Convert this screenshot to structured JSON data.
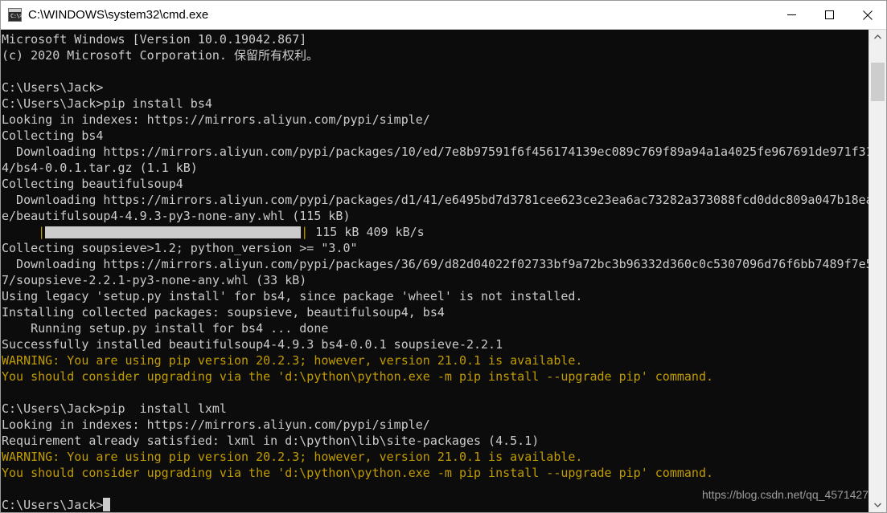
{
  "window": {
    "title": "C:\\WINDOWS\\system32\\cmd.exe",
    "icon": "cmd-icon",
    "icon_glyph": "C:\\>",
    "controls": {
      "minimize_label": "Minimize",
      "maximize_label": "Maximize",
      "close_label": "Close"
    },
    "background_color": "#0c0c0c",
    "titlebar_color": "#ffffff"
  },
  "terminal": {
    "foreground_color": "#cccccc",
    "warning_color": "#c19c00",
    "lines": [
      {
        "text": "Microsoft Windows [Version 10.0.19042.867]",
        "color": "white"
      },
      {
        "text": "(c) 2020 Microsoft Corporation. 保留所有权利。",
        "color": "white"
      },
      {
        "text": "",
        "color": "white"
      },
      {
        "text": "C:\\Users\\Jack>",
        "color": "white"
      },
      {
        "text": "C:\\Users\\Jack>pip install bs4",
        "color": "white"
      },
      {
        "text": "Looking in indexes: https://mirrors.aliyun.com/pypi/simple/",
        "color": "white"
      },
      {
        "text": "Collecting bs4",
        "color": "white"
      },
      {
        "text": "  Downloading https://mirrors.aliyun.com/pypi/packages/10/ed/7e8b97591f6f456174139ec089c769f89a94a1a4025fe967691de971f31",
        "color": "white"
      },
      {
        "text": "4/bs4-0.0.1.tar.gz (1.1 kB)",
        "color": "white"
      },
      {
        "text": "Collecting beautifulsoup4",
        "color": "white"
      },
      {
        "text": "  Downloading https://mirrors.aliyun.com/pypi/packages/d1/41/e6495bd7d3781cee623ce23ea6ac73282a373088fcd0ddc809a047b18ea",
        "color": "white"
      },
      {
        "text": "e/beautifulsoup4-4.9.3-py3-none-any.whl (115 kB)",
        "color": "white"
      },
      {
        "type": "progress",
        "prefix": "     ",
        "suffix": " 115 kB 409 kB/s",
        "pipe": "|",
        "fill_percent": 100
      },
      {
        "text": "Collecting soupsieve>1.2; python_version >= \"3.0\"",
        "color": "white"
      },
      {
        "text": "  Downloading https://mirrors.aliyun.com/pypi/packages/36/69/d82d04022f02733bf9a72bc3b96332d360c0c5307096d76f6bb7489f7e5",
        "color": "white"
      },
      {
        "text": "7/soupsieve-2.2.1-py3-none-any.whl (33 kB)",
        "color": "white"
      },
      {
        "text": "Using legacy 'setup.py install' for bs4, since package 'wheel' is not installed.",
        "color": "white"
      },
      {
        "text": "Installing collected packages: soupsieve, beautifulsoup4, bs4",
        "color": "white"
      },
      {
        "text": "    Running setup.py install for bs4 ... done",
        "color": "white"
      },
      {
        "text": "Successfully installed beautifulsoup4-4.9.3 bs4-0.0.1 soupsieve-2.2.1",
        "color": "white"
      },
      {
        "text": "WARNING: You are using pip version 20.2.3; however, version 21.0.1 is available.",
        "color": "yellow"
      },
      {
        "text": "You should consider upgrading via the 'd:\\python\\python.exe -m pip install --upgrade pip' command.",
        "color": "yellow"
      },
      {
        "text": "",
        "color": "white"
      },
      {
        "text": "C:\\Users\\Jack>pip  install lxml",
        "color": "white"
      },
      {
        "text": "Looking in indexes: https://mirrors.aliyun.com/pypi/simple/",
        "color": "white"
      },
      {
        "text": "Requirement already satisfied: lxml in d:\\python\\lib\\site-packages (4.5.1)",
        "color": "white"
      },
      {
        "text": "WARNING: You are using pip version 20.2.3; however, version 21.0.1 is available.",
        "color": "yellow"
      },
      {
        "text": "You should consider upgrading via the 'd:\\python\\python.exe -m pip install --upgrade pip' command.",
        "color": "yellow"
      },
      {
        "text": "",
        "color": "white"
      },
      {
        "type": "prompt",
        "text": "C:\\Users\\Jack>",
        "color": "white",
        "cursor": true
      }
    ]
  },
  "watermark": {
    "text": "https://blog.csdn.net/qq_4571427"
  },
  "scrollbar": {
    "up_arrow": "chevron-up-icon",
    "down_arrow": "chevron-down-icon",
    "thumb_position_percent": 4
  }
}
